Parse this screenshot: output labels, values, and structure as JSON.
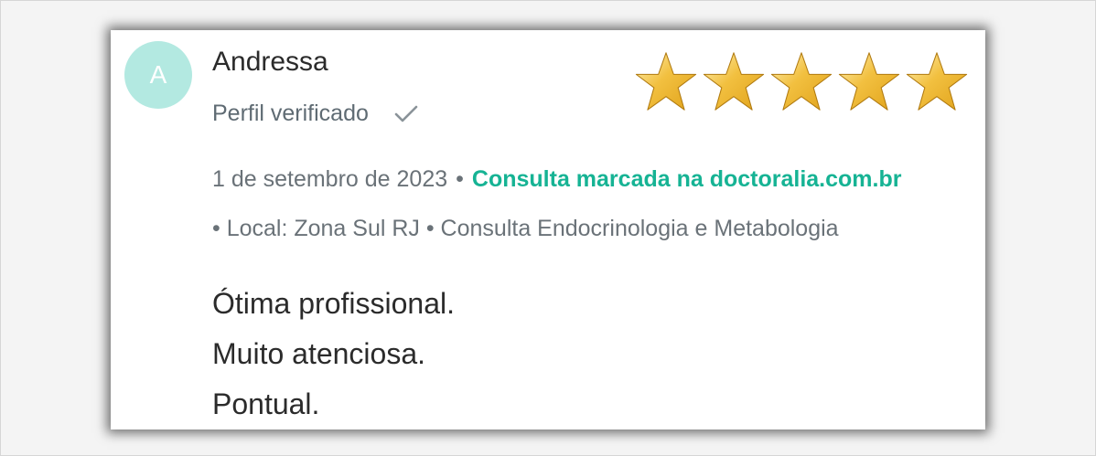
{
  "review": {
    "avatar_initial": "A",
    "reviewer_name": "Andressa",
    "verified_label": "Perfil verificado",
    "rating": 5,
    "rating_max": 5,
    "date": "1 de setembro de 2023",
    "separator": "•",
    "booking_note": "Consulta marcada na doctoralia.com.br",
    "details": "• Local: Zona Sul RJ • Consulta Endocrinologia e Metabologia",
    "text_lines": [
      "Ótima profissional.",
      "Muito atenciosa.",
      "Pontual."
    ]
  },
  "colors": {
    "avatar_bg": "#b3e9e1",
    "accent_green": "#16b394",
    "star_gold": "#e0a21a"
  },
  "icons": {
    "verified": "check-icon",
    "rating": "star-icon"
  }
}
